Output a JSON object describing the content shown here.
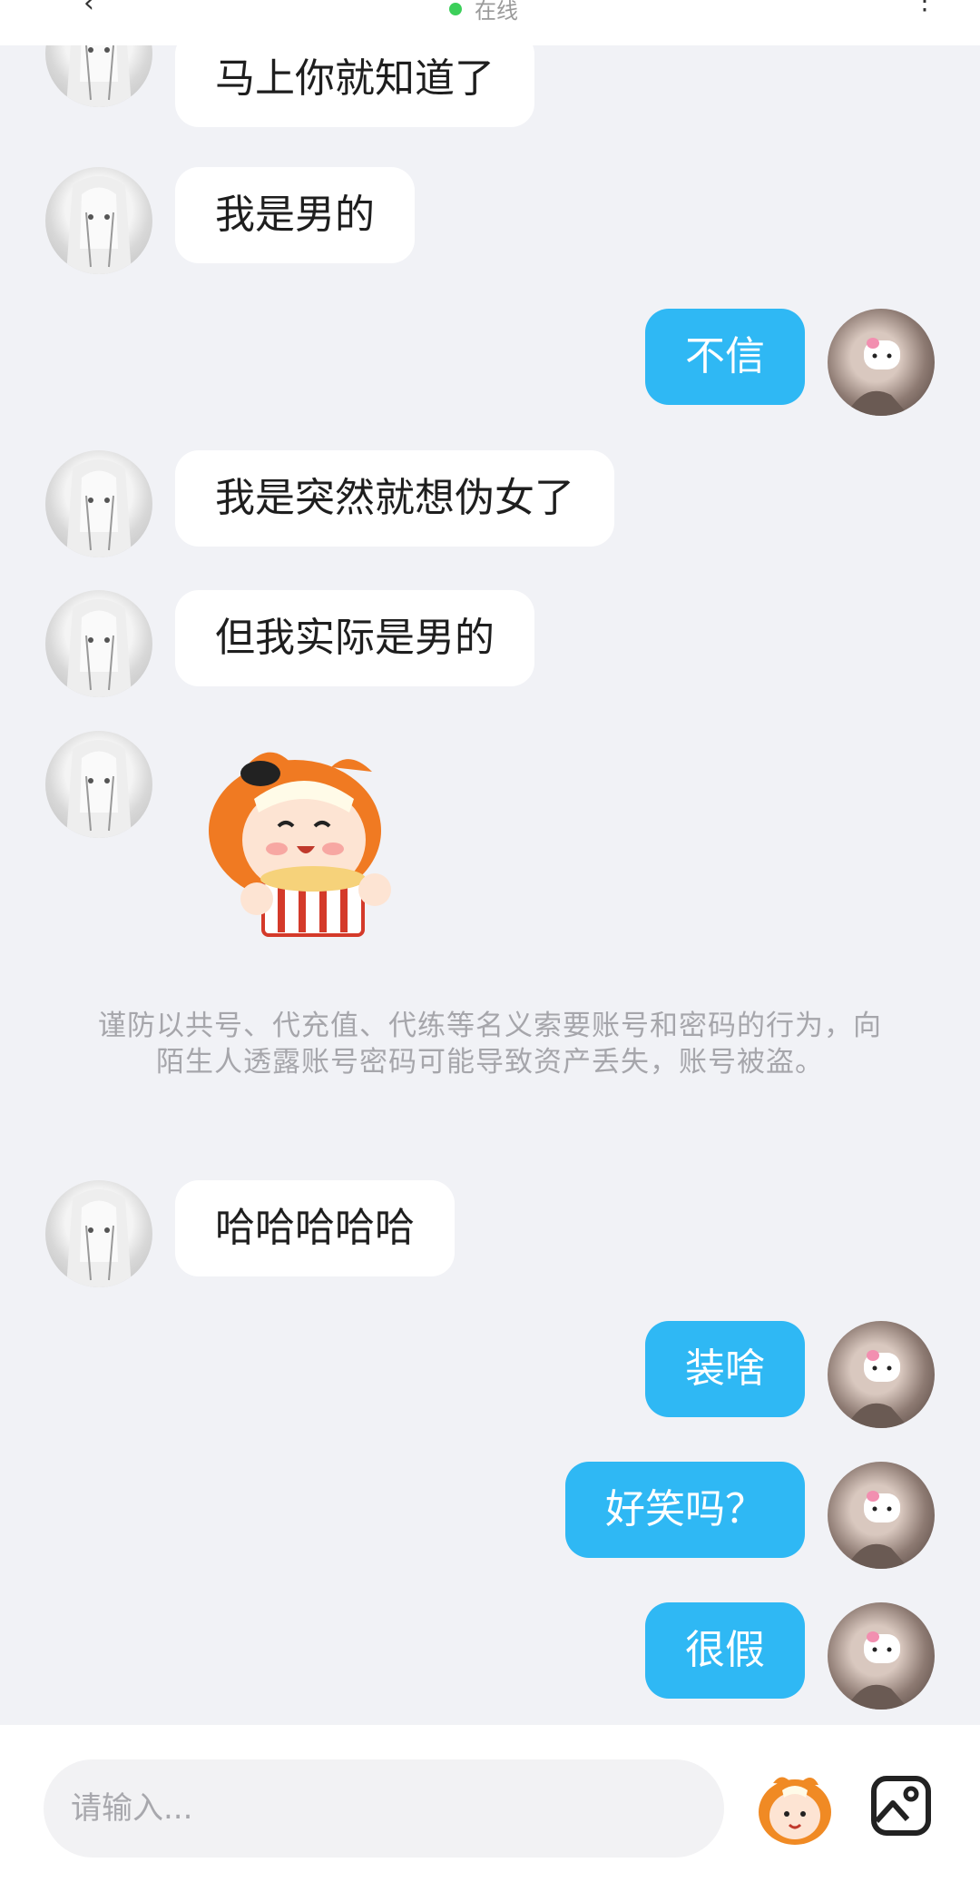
{
  "header": {
    "status": "在线",
    "status_color": "#3ccf5a"
  },
  "messages": [
    {
      "side": "left",
      "text": "马上你就知道了"
    },
    {
      "side": "left",
      "text": "我是男的"
    },
    {
      "side": "right",
      "text": "不信"
    },
    {
      "side": "left",
      "text": "我是突然就想伪女了"
    },
    {
      "side": "left",
      "text": "但我实际是男的"
    },
    {
      "side": "left",
      "sticker": "popcorn-girl-sticker"
    },
    {
      "side": "left",
      "text": "哈哈哈哈哈"
    },
    {
      "side": "right",
      "text": "装啥"
    },
    {
      "side": "right",
      "text": "好笑吗？"
    },
    {
      "side": "right",
      "text": "很假"
    }
  ],
  "notice": "谨防以共号、代充值、代练等名义索要账号和密码的行为，向陌生人透露账号密码可能导致资产丢失，账号被盗。",
  "composer": {
    "placeholder": "请输入...",
    "emoji_icon": "emoji-icon",
    "image_icon": "image-icon"
  },
  "colors": {
    "accent": "#2fb8f4",
    "background": "#f1f2f6",
    "bubble_left": "#ffffff"
  }
}
